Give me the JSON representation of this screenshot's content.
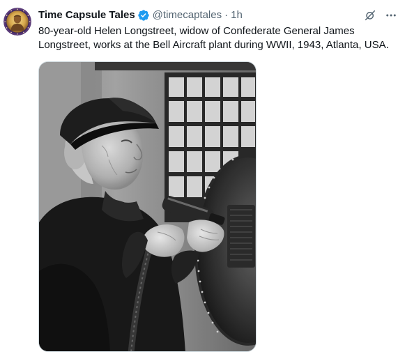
{
  "tweet": {
    "author": {
      "display_name": "Time Capsule Tales",
      "handle": "@timecaptales",
      "verified": true,
      "avatar_icon": "portrait-medallion-avatar"
    },
    "separator": "·",
    "time": "1h",
    "text": "80-year-old Helen Longstreet, widow of Confederate General James Longstreet, works at the Bell Aircraft plant during WWII, 1943, Atlanta, USA.",
    "actions": [
      {
        "name": "grok-icon"
      },
      {
        "name": "more-icon"
      }
    ],
    "media": {
      "type": "photo",
      "style": "black-and-white"
    }
  },
  "colors": {
    "text_primary": "#0f1419",
    "text_secondary": "#536471",
    "verified_blue": "#1d9bf0",
    "media_border": "#cfd9de"
  }
}
